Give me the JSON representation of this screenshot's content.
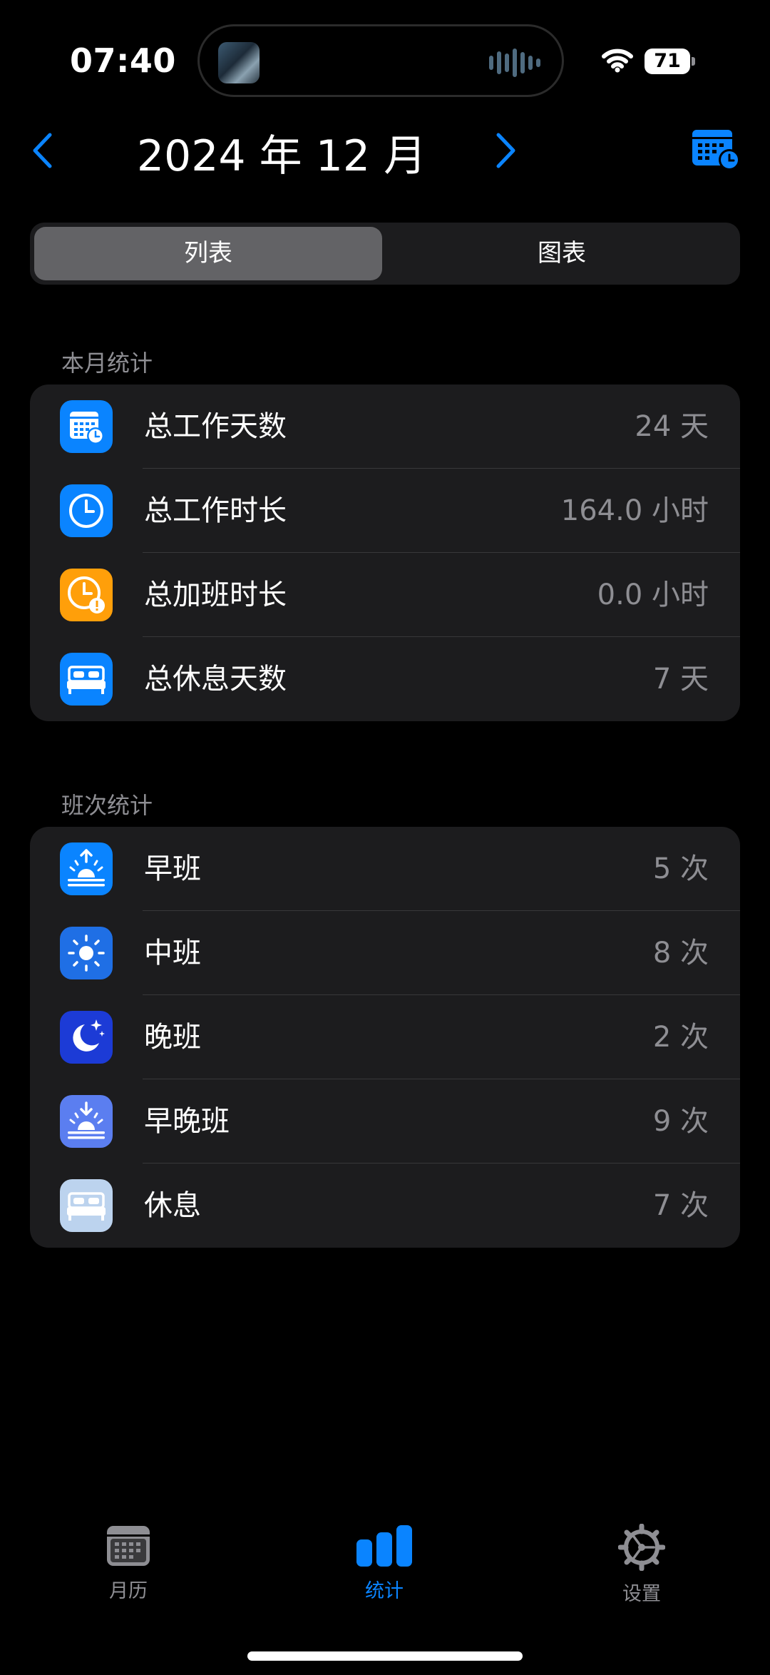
{
  "status": {
    "time": "07:40",
    "battery": "71"
  },
  "header": {
    "title": "2024 年 12 月"
  },
  "segment": {
    "options": [
      "列表",
      "图表"
    ],
    "selected": "列表"
  },
  "monthly": {
    "section_title": "本月统计",
    "rows": [
      {
        "icon": "calendar-clock-icon",
        "label": "总工作天数",
        "value": "24 天"
      },
      {
        "icon": "clock-icon",
        "label": "总工作时长",
        "value": "164.0 小时"
      },
      {
        "icon": "clock-alert-icon",
        "label": "总加班时长",
        "value": "0.0 小时"
      },
      {
        "icon": "bed-icon",
        "label": "总休息天数",
        "value": "7 天"
      }
    ]
  },
  "shifts": {
    "section_title": "班次统计",
    "rows": [
      {
        "icon": "sunrise-icon",
        "label": "早班",
        "value": "5 次"
      },
      {
        "icon": "sun-icon",
        "label": "中班",
        "value": "8 次"
      },
      {
        "icon": "moon-stars-icon",
        "label": "晚班",
        "value": "2 次"
      },
      {
        "icon": "sunset-icon",
        "label": "早晚班",
        "value": "9 次"
      },
      {
        "icon": "bed-icon",
        "label": "休息",
        "value": "7 次"
      }
    ]
  },
  "tabbar": {
    "items": [
      {
        "label": "月历",
        "icon": "calendar-icon"
      },
      {
        "label": "统计",
        "icon": "bar-chart-icon",
        "active": true
      },
      {
        "label": "设置",
        "icon": "gear-icon"
      }
    ]
  },
  "colors": {
    "accent": "#0a84ff",
    "orange": "#ff9f0a",
    "indigo": "#1c3bd6",
    "periwinkle": "#5b7ef0",
    "pale_blue": "#bcd3ee",
    "card": "#1c1c1e"
  }
}
